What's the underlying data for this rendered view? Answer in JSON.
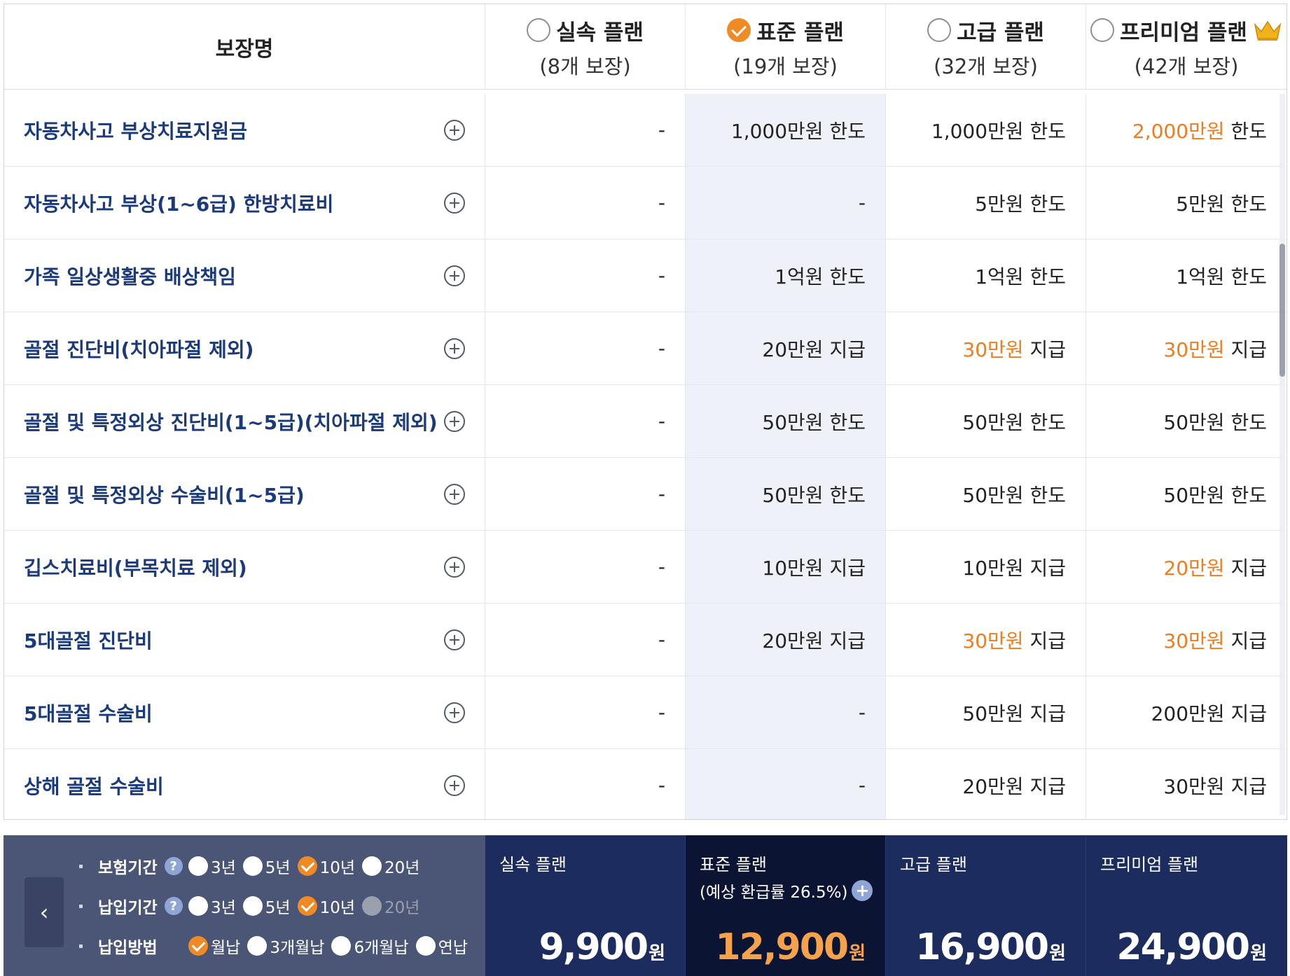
{
  "header": {
    "coverage_name": "보장명",
    "plans": [
      {
        "name": "실속 플랜",
        "count": "(8개 보장)",
        "selected": false,
        "crown": false
      },
      {
        "name": "표준 플랜",
        "count": "(19개 보장)",
        "selected": true,
        "crown": false
      },
      {
        "name": "고급 플랜",
        "count": "(32개 보장)",
        "selected": false,
        "crown": false
      },
      {
        "name": "프리미엄 플랜",
        "count": "(42개 보장)",
        "selected": false,
        "crown": true
      }
    ]
  },
  "rows": [
    {
      "name": "자동차사고 부상치료지원금",
      "values": [
        {
          "amt": "-",
          "unit": ""
        },
        {
          "amt": "1,000만원",
          "unit": " 한도"
        },
        {
          "amt": "1,000만원",
          "unit": " 한도"
        },
        {
          "amt": "2,000만원",
          "unit": " 한도",
          "hl": true
        }
      ]
    },
    {
      "name": "자동차사고 부상(1~6급) 한방치료비",
      "values": [
        {
          "amt": "-",
          "unit": ""
        },
        {
          "amt": "-",
          "unit": ""
        },
        {
          "amt": "5만원",
          "unit": " 한도"
        },
        {
          "amt": "5만원",
          "unit": " 한도"
        }
      ]
    },
    {
      "name": "가족 일상생활중 배상책임",
      "values": [
        {
          "amt": "-",
          "unit": ""
        },
        {
          "amt": "1억원",
          "unit": " 한도"
        },
        {
          "amt": "1억원",
          "unit": " 한도"
        },
        {
          "amt": "1억원",
          "unit": " 한도"
        }
      ]
    },
    {
      "name": "골절 진단비(치아파절 제외)",
      "values": [
        {
          "amt": "-",
          "unit": ""
        },
        {
          "amt": "20만원",
          "unit": " 지급"
        },
        {
          "amt": "30만원",
          "unit": " 지급",
          "hl": true
        },
        {
          "amt": "30만원",
          "unit": " 지급",
          "hl": true
        }
      ]
    },
    {
      "name": "골절 및 특정외상 진단비(1~5급)(치아파절 제외)",
      "values": [
        {
          "amt": "-",
          "unit": ""
        },
        {
          "amt": "50만원",
          "unit": " 한도"
        },
        {
          "amt": "50만원",
          "unit": " 한도"
        },
        {
          "amt": "50만원",
          "unit": " 한도"
        }
      ]
    },
    {
      "name": "골절 및 특정외상 수술비(1~5급)",
      "values": [
        {
          "amt": "-",
          "unit": ""
        },
        {
          "amt": "50만원",
          "unit": " 한도"
        },
        {
          "amt": "50만원",
          "unit": " 한도"
        },
        {
          "amt": "50만원",
          "unit": " 한도"
        }
      ]
    },
    {
      "name": "깁스치료비(부목치료 제외)",
      "values": [
        {
          "amt": "-",
          "unit": ""
        },
        {
          "amt": "10만원",
          "unit": " 지급"
        },
        {
          "amt": "10만원",
          "unit": " 지급"
        },
        {
          "amt": "20만원",
          "unit": " 지급",
          "hl": true
        }
      ]
    },
    {
      "name": "5대골절 진단비",
      "values": [
        {
          "amt": "-",
          "unit": ""
        },
        {
          "amt": "20만원",
          "unit": " 지급"
        },
        {
          "amt": "30만원",
          "unit": " 지급",
          "hl": true
        },
        {
          "amt": "30만원",
          "unit": " 지급",
          "hl": true
        }
      ]
    },
    {
      "name": "5대골절 수술비",
      "values": [
        {
          "amt": "-",
          "unit": ""
        },
        {
          "amt": "-",
          "unit": ""
        },
        {
          "amt": "50만원",
          "unit": " 지급"
        },
        {
          "amt": "200만원",
          "unit": " 지급"
        }
      ]
    },
    {
      "name": "상해 골절 수술비",
      "values": [
        {
          "amt": "-",
          "unit": ""
        },
        {
          "amt": "-",
          "unit": ""
        },
        {
          "amt": "20만원",
          "unit": " 지급"
        },
        {
          "amt": "30만원",
          "unit": " 지급"
        }
      ]
    }
  ],
  "options": {
    "insurance_period": {
      "label": "보험기간",
      "help": "?",
      "choices": [
        {
          "t": "3년",
          "s": false
        },
        {
          "t": "5년",
          "s": false
        },
        {
          "t": "10년",
          "s": true
        },
        {
          "t": "20년",
          "s": false
        }
      ]
    },
    "payment_period": {
      "label": "납입기간",
      "help": "?",
      "choices": [
        {
          "t": "3년",
          "s": false
        },
        {
          "t": "5년",
          "s": false
        },
        {
          "t": "10년",
          "s": true
        },
        {
          "t": "20년",
          "s": false,
          "d": true
        }
      ]
    },
    "payment_method": {
      "label": "납입방법",
      "choices": [
        {
          "t": "월납",
          "s": true
        },
        {
          "t": "3개월납",
          "s": false
        },
        {
          "t": "6개월납",
          "s": false
        },
        {
          "t": "연납",
          "s": false
        }
      ]
    },
    "prev_icon": "‹"
  },
  "prices": [
    {
      "name": "실속 플랜",
      "sub": "",
      "amount": "9,900",
      "unit": "원"
    },
    {
      "name": "표준 플랜",
      "sub": "(예상 환급률 26.5%)",
      "amount": "12,900",
      "unit": " 원"
    },
    {
      "name": "고급 플랜",
      "sub": "",
      "amount": "16,900",
      "unit": "원"
    },
    {
      "name": "프리미엄 플랜",
      "sub": "",
      "amount": "24,900",
      "unit": "원"
    }
  ],
  "colors": {
    "highlight": "#f07c1e",
    "accent": "#f08a24",
    "navy": "#1d2c5e"
  }
}
